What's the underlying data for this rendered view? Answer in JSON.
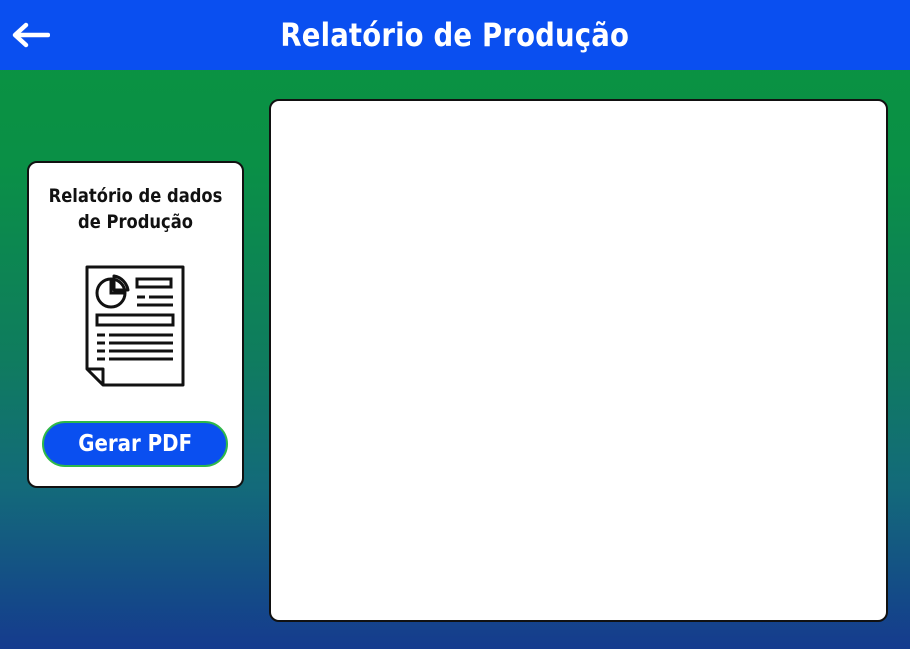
{
  "header": {
    "title": "Relatório de Produção",
    "back_icon": "arrow-left-icon"
  },
  "report_card": {
    "title_line1": "Relatório de dados",
    "title_line2": "de Produção",
    "icon": "document-report-icon",
    "button_label": "Gerar PDF"
  },
  "colors": {
    "header_bg": "#0a4ff0",
    "button_bg": "#0a4ff0",
    "button_border": "#2fb84a",
    "gradient_top": "#0b9340",
    "gradient_bottom": "#153b8e"
  }
}
